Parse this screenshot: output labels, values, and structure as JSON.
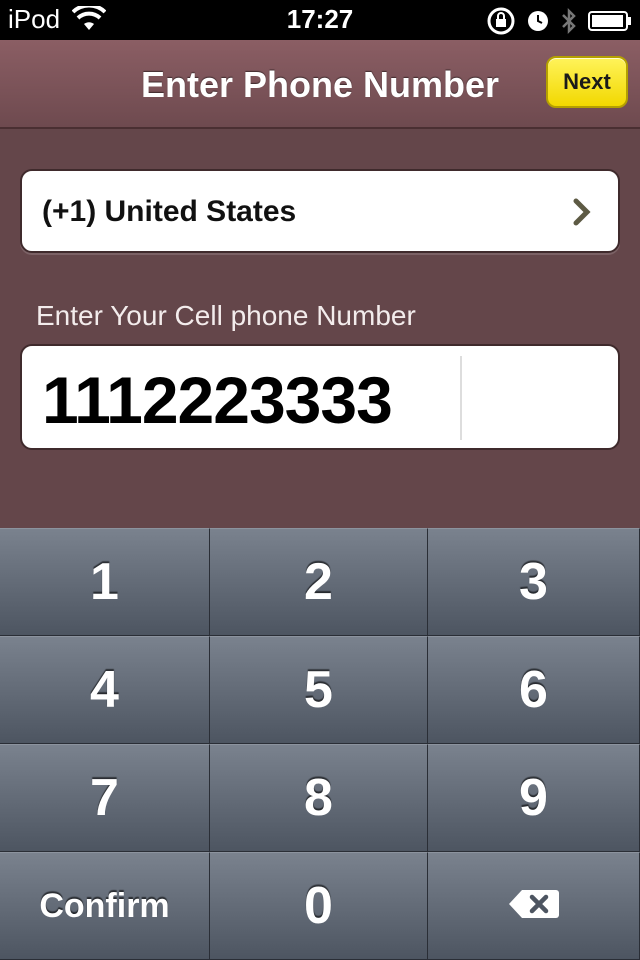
{
  "status_bar": {
    "device": "iPod",
    "time": "17:27",
    "icons": [
      "wifi-icon",
      "rotation-lock-icon",
      "alarm-icon",
      "bluetooth-icon",
      "battery-icon"
    ]
  },
  "navbar": {
    "title": "Enter Phone Number",
    "next_label": "Next"
  },
  "country": {
    "label": "(+1) United States"
  },
  "phone": {
    "prompt": "Enter Your Cell phone Number",
    "value": "1112223333"
  },
  "keypad": {
    "keys": [
      "1",
      "2",
      "3",
      "4",
      "5",
      "6",
      "7",
      "8",
      "9"
    ],
    "confirm_label": "Confirm",
    "zero": "0"
  },
  "colors": {
    "background": "#64464a",
    "navbar": "#7a5156",
    "next_button": "#f7e51a",
    "keypad": "#5d6571"
  }
}
